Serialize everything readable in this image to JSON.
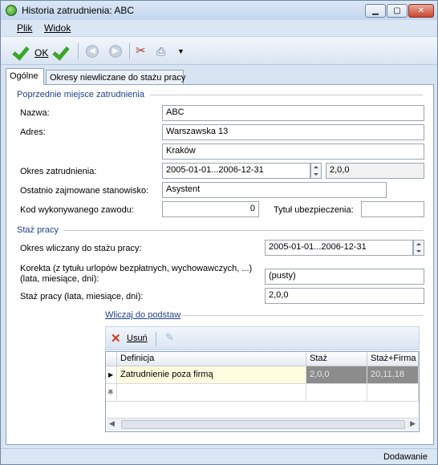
{
  "window": {
    "title": "Historia zatrudnienia: ABC",
    "minimize": "▁",
    "maximize": "▢",
    "close": "✕"
  },
  "menu": {
    "file": "Plik",
    "view": "Widok"
  },
  "toolbar": {
    "ok_label": "OK"
  },
  "tabs": [
    {
      "label": "Ogólne"
    },
    {
      "label": "Okresy niewliczane do stażu pracy"
    }
  ],
  "section1": {
    "title": "Poprzednie miejsce zatrudnienia",
    "name_label": "Nazwa:",
    "name_value": "ABC",
    "address_label": "Adres:",
    "address_line1": "Warszawska 13",
    "address_line2": "Kraków",
    "period_label": "Okres zatrudnienia:",
    "period_value": "2005-01-01...2006-12-31",
    "period_length": "2,0,0",
    "position_label": "Ostatnio zajmowane stanowisko:",
    "position_value": "Asystent",
    "code_label": "Kod wykonywanego zawodu:",
    "code_value": "0",
    "insurance_label": "Tytuł ubezpieczenia:",
    "insurance_value": ""
  },
  "section2": {
    "title": "Staż pracy",
    "counted_label": "Okres wliczany do stażu pracy:",
    "counted_value": "2005-01-01...2006-12-31",
    "correction_label_1": "Korekta (z tytułu urlopów bezpłatnych, wychowawczych, ...)",
    "correction_label_2": "(lata, miesiące, dni):",
    "correction_value": "(pusty)",
    "seniority_label": "Staż pracy (lata, miesiące, dni):",
    "seniority_value": "2,0,0"
  },
  "basis": {
    "title": "Wliczaj do podstaw",
    "delete_label": "Usuń",
    "columns": [
      "Definicja",
      "Staż",
      "Staż+Firma"
    ],
    "rows": [
      {
        "definition": "Zatrudnienie poza firmą",
        "staz": "2,0,0",
        "staz_firma": "20,11,18"
      }
    ],
    "new_row_marker": "※"
  },
  "status": {
    "text": "Dodawanie"
  }
}
